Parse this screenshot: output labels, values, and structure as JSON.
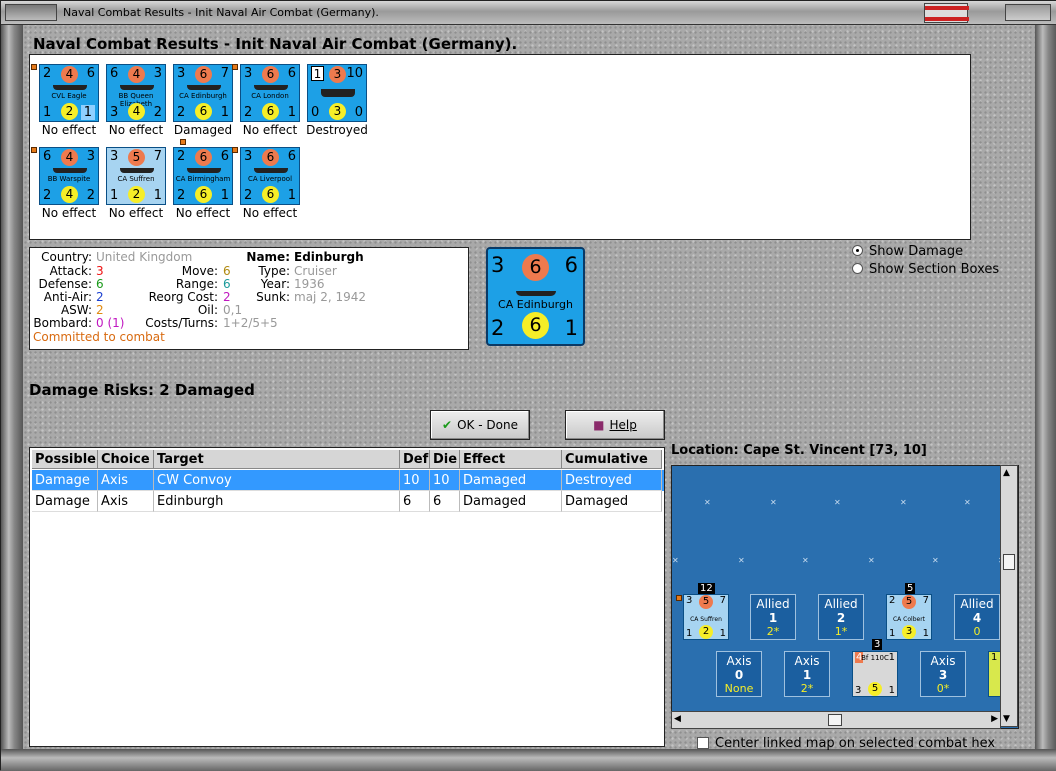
{
  "window": {
    "title": "Naval Combat Results - Init Naval Air Combat (Germany)."
  },
  "heading": "Naval Combat Results - Init Naval Air Combat (Germany).",
  "units_row1": [
    {
      "name": "CVL Eagle",
      "tl": "2",
      "tc": "4",
      "tr": "6",
      "bl": "1",
      "bc": "2",
      "br": "1",
      "result": "No effect",
      "light": false
    },
    {
      "name": "BB Queen Elizabeth",
      "tl": "6",
      "tc": "4",
      "tr": "3",
      "bl": "3",
      "bc": "4",
      "br": "2",
      "result": "No effect",
      "light": false
    },
    {
      "name": "CA Edinburgh",
      "tl": "3",
      "tc": "6",
      "tr": "7",
      "bl": "2",
      "bc": "6",
      "br": "1",
      "result": "Damaged",
      "light": false
    },
    {
      "name": "CA London",
      "tl": "3",
      "tc": "6",
      "tr": "6",
      "bl": "2",
      "bc": "6",
      "br": "1",
      "result": "No effect",
      "light": false
    },
    {
      "name": "",
      "tl": "1",
      "tc": "3",
      "tr": "10",
      "bl": "0",
      "bc": "3",
      "br": "0",
      "result": "Destroyed",
      "light": false
    }
  ],
  "units_row2": [
    {
      "name": "BB Warspite",
      "tl": "6",
      "tc": "4",
      "tr": "3",
      "bl": "2",
      "bc": "4",
      "br": "2",
      "result": "No effect",
      "light": false
    },
    {
      "name": "CA Suffren",
      "tl": "3",
      "tc": "5",
      "tr": "7",
      "bl": "1",
      "bc": "2",
      "br": "1",
      "result": "No effect",
      "light": true
    },
    {
      "name": "CA Birmingham",
      "tl": "2",
      "tc": "6",
      "tr": "6",
      "bl": "2",
      "bc": "6",
      "br": "1",
      "result": "No effect",
      "light": false
    },
    {
      "name": "CA Liverpool",
      "tl": "3",
      "tc": "6",
      "tr": "6",
      "bl": "2",
      "bc": "6",
      "br": "1",
      "result": "No effect",
      "light": false
    }
  ],
  "info": {
    "country_lbl": "Country:",
    "country": "United Kingdom",
    "attack_lbl": "Attack:",
    "attack": "3",
    "defense_lbl": "Defense:",
    "defense": "6",
    "antiair_lbl": "Anti-Air:",
    "antiair": "2",
    "asw_lbl": "ASW:",
    "asw": "2",
    "bombard_lbl": "Bombard:",
    "bombard": "0 (1)",
    "move_lbl": "Move:",
    "move": "6",
    "range_lbl": "Range:",
    "range": "6",
    "reorg_lbl": "Reorg Cost:",
    "reorg": "2",
    "oil_lbl": "Oil:",
    "oil": "0,1",
    "costs_lbl": "Costs/Turns:",
    "costs": "1+2/5+5",
    "name_lbl": "Name:",
    "name": "Edinburgh",
    "type_lbl": "Type:",
    "type": "Cruiser",
    "year_lbl": "Year:",
    "year": "1936",
    "sunk_lbl": "Sunk:",
    "sunk": "maj 2, 1942",
    "status": "Committed to combat"
  },
  "big_unit": {
    "tl": "3",
    "tc": "6",
    "tr": "6",
    "bl": "2",
    "bc": "6",
    "br": "1",
    "name": "CA Edinburgh"
  },
  "options": {
    "show_damage": "Show Damage",
    "show_sections": "Show Section Boxes"
  },
  "damage_risks": "Damage Risks:  2 Damaged",
  "buttons": {
    "ok": "OK - Done",
    "help": "Help"
  },
  "table": {
    "headers": [
      "Possible",
      "Choice",
      "Target",
      "Def",
      "Die",
      "Effect",
      "Cumulative"
    ],
    "rows": [
      [
        "Damage",
        "Axis",
        "CW Convoy",
        "10",
        "10",
        "Damaged",
        "Destroyed"
      ],
      [
        "Damage",
        "Axis",
        "Edinburgh",
        "6",
        "6",
        "Damaged",
        "Damaged"
      ]
    ]
  },
  "location": "Location:  Cape St. Vincent [73, 10]",
  "map": {
    "allied": [
      {
        "side": "Allied",
        "count": "1",
        "val": "2*"
      },
      {
        "side": "Allied",
        "count": "2",
        "val": "1*"
      },
      {
        "side": "Allied",
        "count": "4",
        "val": "0"
      }
    ],
    "axis": [
      {
        "side": "Axis",
        "count": "0",
        "val": "None"
      },
      {
        "side": "Axis",
        "count": "1",
        "val": "2*"
      },
      {
        "side": "Axis",
        "count": "3",
        "val": "0*"
      }
    ],
    "stack1": {
      "count": "12",
      "name": "CA Suffren",
      "tl": "3",
      "tc": "5",
      "tr": "7",
      "bl": "1",
      "bc": "2",
      "br": "1"
    },
    "stack2": {
      "count": "5",
      "name": "CA Colbert",
      "tl": "2",
      "tc": "5",
      "tr": "7",
      "bl": "1",
      "bc": "3",
      "br": "1"
    },
    "stack3": {
      "count": "3",
      "name": "Bf 110C",
      "tl": "4",
      "tc": "",
      "tr": "1",
      "bl": "3",
      "bc": "5",
      "br": "1"
    },
    "partial": "1"
  },
  "center_label": "Center linked map on selected combat hex"
}
